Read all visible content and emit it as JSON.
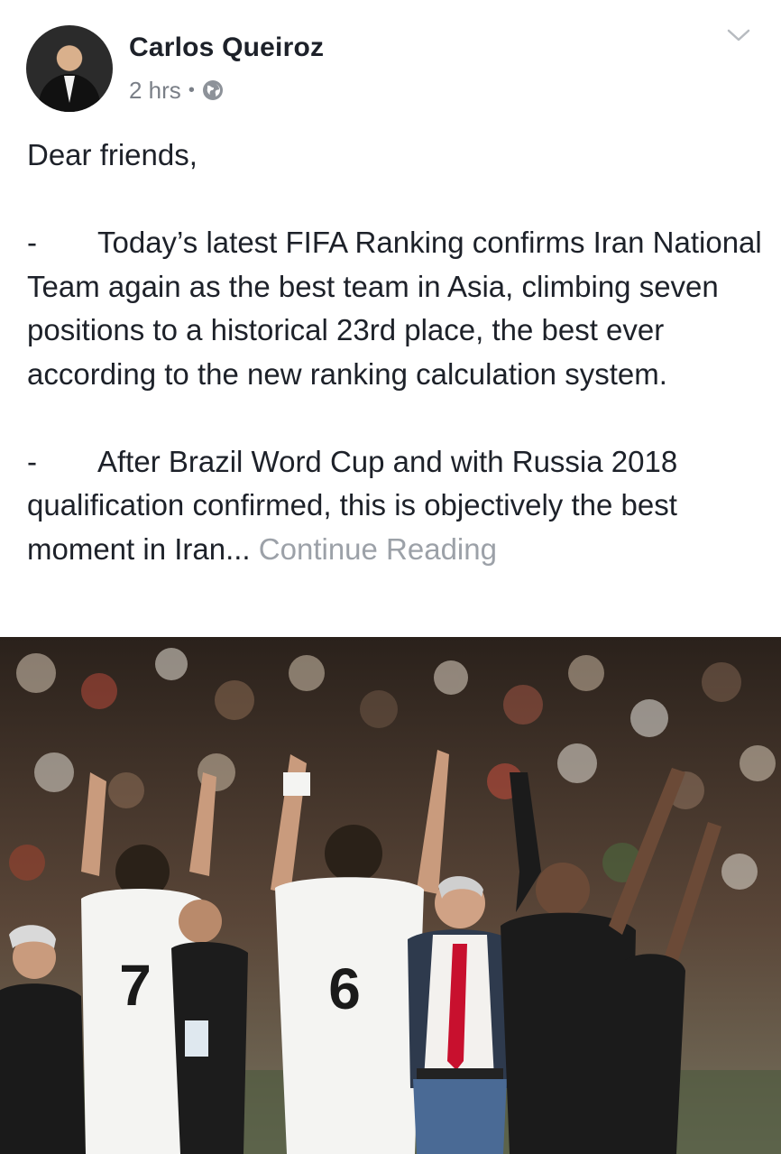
{
  "post": {
    "author": "Carlos Queiroz",
    "time": "2 hrs",
    "separator": "•",
    "privacy_icon": "globe-icon",
    "menu_icon": "chevron-down-icon",
    "greeting": "Dear friends,",
    "bullet": "-",
    "paragraph1": "Today’s latest FIFA Ranking confirms Iran National Team again as the best team in Asia, climbing seven positions to a historical 23rd place, the best ever according to the new ranking calculation system.",
    "paragraph2": "After Brazil Word Cup and with Russia 2018 qualification confirmed, this is objectively the best moment in Iran...",
    "continue_label": "Continue Reading"
  },
  "photo": {
    "player_left_number": "7",
    "player_right_number": "6"
  },
  "colors": {
    "text": "#1d2129",
    "meta": "#7a7f87",
    "link_muted": "#9ca1a8",
    "jersey": "#f4f4f2",
    "tie": "#c8102e"
  }
}
